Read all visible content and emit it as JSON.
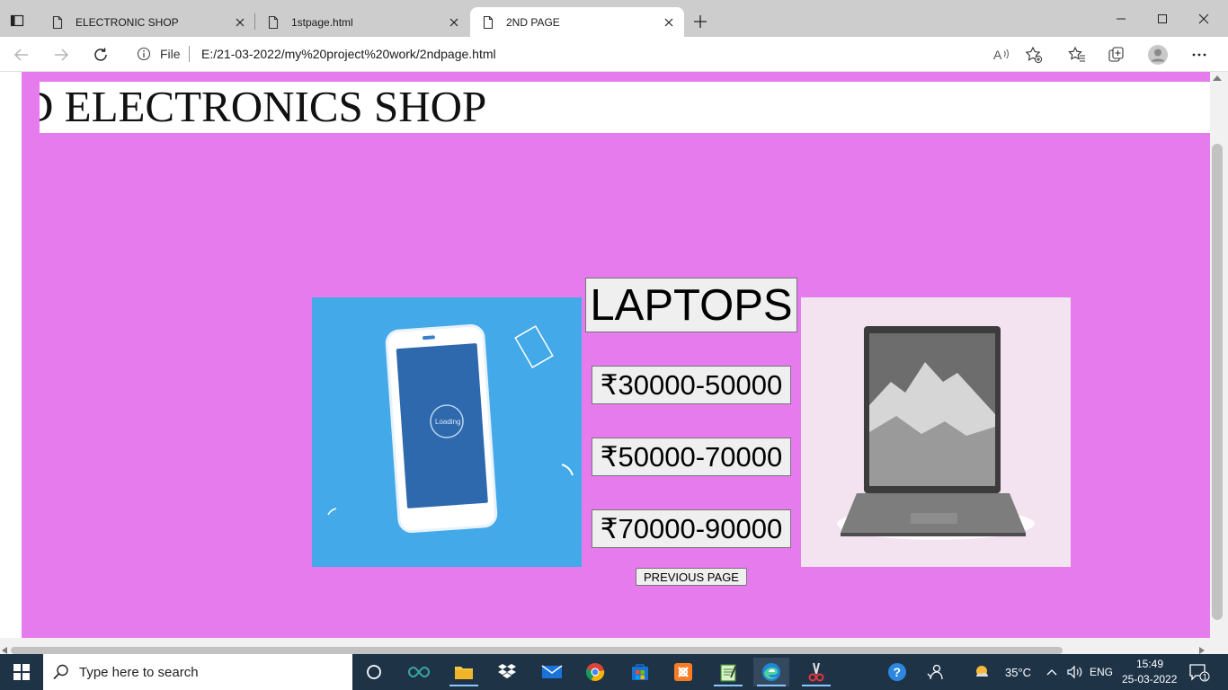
{
  "browser": {
    "tabs": [
      {
        "title": "ELECTRONIC SHOP",
        "active": false
      },
      {
        "title": "1stpage.html",
        "active": false
      },
      {
        "title": "2ND PAGE",
        "active": true
      }
    ],
    "address": {
      "site_label": "File",
      "url": "E:/21-03-2022/my%20project%20work/2ndpage.html"
    }
  },
  "page": {
    "marquee_text": "D ELECTRONICS SHOP",
    "heading": "LAPTOPS",
    "price_ranges": [
      "₹30000-50000",
      "₹50000-70000",
      "₹70000-90000"
    ],
    "previous_button": "PREVIOUS PAGE",
    "phone_image_text": "Loading",
    "colors": {
      "page_background": "#e57bec",
      "phone_image_bg": "#43a9e9",
      "laptop_image_bg": "#f3e2ef"
    }
  },
  "taskbar": {
    "search_placeholder": "Type here to search",
    "weather": "35°C",
    "language": "ENG",
    "time": "15:49",
    "date": "25-03-2022",
    "notification_count": "1",
    "icons": [
      "start-icon",
      "cortana-icon",
      "arduino-icon",
      "file-explorer-icon",
      "dropbox-icon",
      "mail-icon",
      "chrome-icon",
      "store-icon",
      "xampp-icon",
      "notepad-icon",
      "edge-icon",
      "snipping-tool-icon"
    ]
  }
}
